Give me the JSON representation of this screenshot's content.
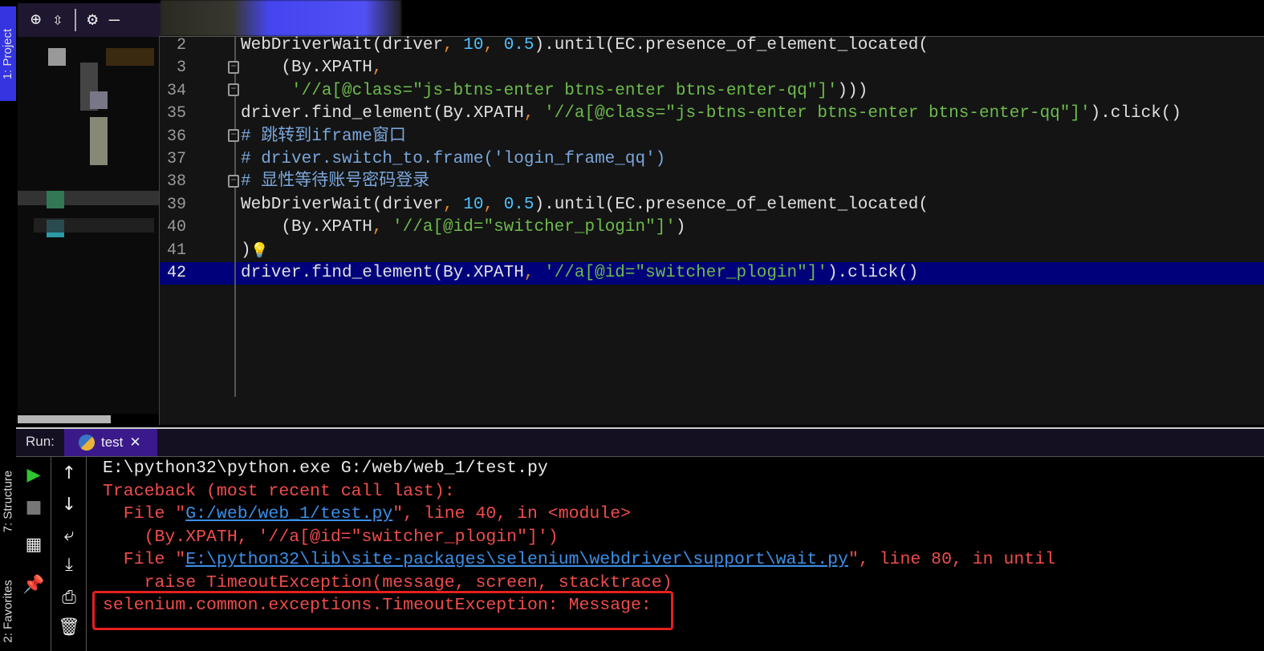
{
  "side_tabs": {
    "project": "1: Project",
    "structure": "7: Structure",
    "favorites": "2: Favorites"
  },
  "project_toolbar": {
    "locate": "locate-icon",
    "collapse": "collapse-icon",
    "settings": "gear-icon",
    "hide": "minimize-icon"
  },
  "editor": {
    "lines": [
      {
        "num": "2",
        "code": "WebDriverWait(driver, 10, 0.5).until(EC.presence_of_element_located("
      },
      {
        "num": "3",
        "code": "    (By.XPATH,"
      },
      {
        "num": "34",
        "code": "     '//a[@class=\"js-btns-enter btns-enter btns-enter-qq\"]')))"
      },
      {
        "num": "35",
        "code": "driver.find_element(By.XPATH, '//a[@class=\"js-btns-enter btns-enter btns-enter-qq\"]').click()"
      },
      {
        "num": "36",
        "code": "# 跳转到iframe窗口"
      },
      {
        "num": "37",
        "code": "# driver.switch_to.frame('login_frame_qq')"
      },
      {
        "num": "38",
        "code": "# 显性等待账号密码登录"
      },
      {
        "num": "39",
        "code": "WebDriverWait(driver, 10, 0.5).until(EC.presence_of_element_located("
      },
      {
        "num": "40",
        "code": "    (By.XPATH, '//a[@id=\"switcher_plogin\"]')"
      },
      {
        "num": "41",
        "code": ")"
      },
      {
        "num": "42",
        "code": "driver.find_element(By.XPATH, '//a[@id=\"switcher_plogin\"]').click()"
      }
    ],
    "current_line": "42"
  },
  "run": {
    "label": "Run:",
    "tab": "test",
    "output": [
      "E:\\python32\\python.exe G:/web/web_1/test.py",
      "Traceback (most recent call last):",
      "  File \"G:/web/web_1/test.py\", line 40, in <module>",
      "    (By.XPATH, '//a[@id=\"switcher_plogin\"]')",
      "  File \"E:\\python32\\lib\\site-packages\\selenium\\webdriver\\support\\wait.py\", line 80, in until",
      "    raise TimeoutException(message, screen, stacktrace)",
      "selenium.common.exceptions.TimeoutException: Message:"
    ],
    "parts": {
      "f1_pre": "  File \"",
      "f1_link": "G:/web/web_1/test.py",
      "f1_post": "\", line 40, in <module>",
      "f2_pre": "  File \"",
      "f2_link": "E:\\python32\\lib\\site-packages\\selenium\\webdriver\\support\\wait.py",
      "f2_post": "\", line 80, in until"
    }
  },
  "colors": {
    "highlight": "#00007a",
    "error": "#f04c4c",
    "link": "#3b8fe8",
    "accent": "#3a1a8a"
  }
}
